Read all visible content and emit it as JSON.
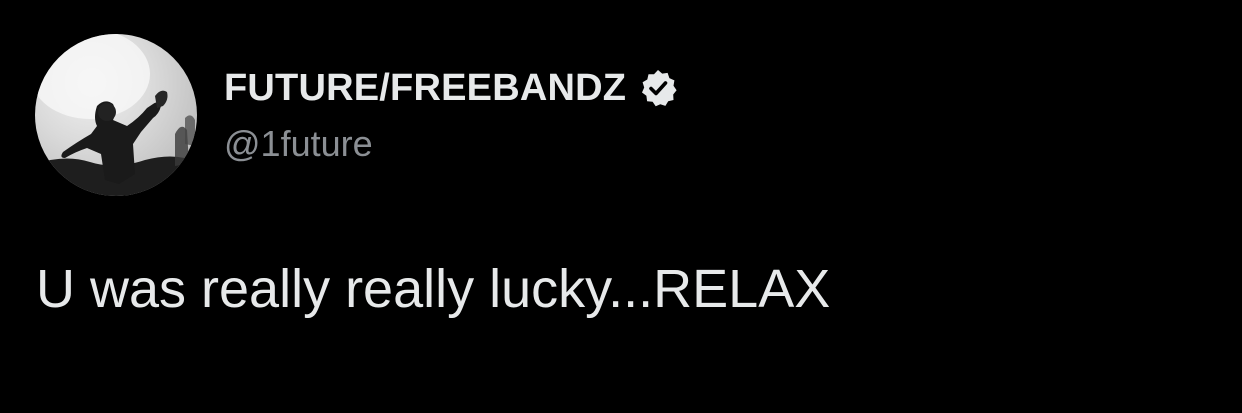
{
  "tweet": {
    "author": {
      "display_name": "FUTURE/FREEBANDZ",
      "handle": "@1future",
      "verified": true,
      "avatar_icon": "profile-photo-avatar",
      "verified_icon": "verified-badge-icon"
    },
    "text": "U was really really lucky...RELAX"
  },
  "colors": {
    "background": "#000000",
    "primary_text": "#e7e9ea",
    "secondary_text": "#8b8f94",
    "badge": "#e7e9ea"
  }
}
